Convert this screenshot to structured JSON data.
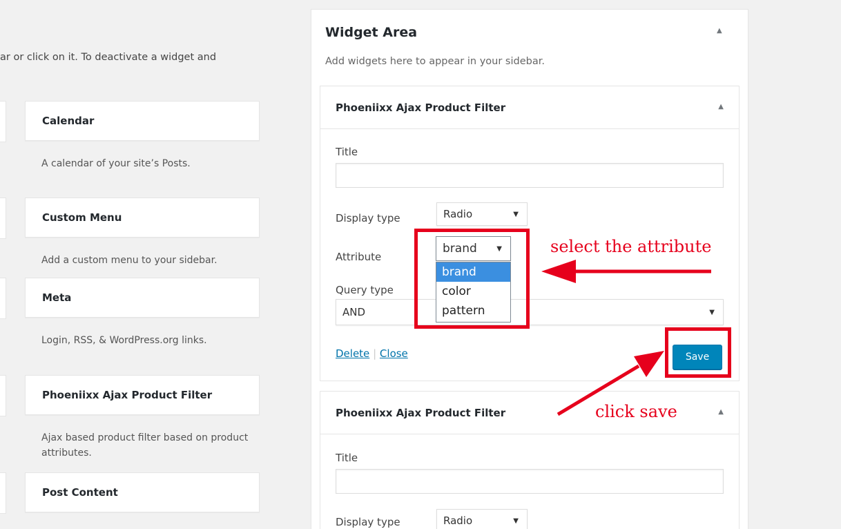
{
  "intro_text": "ar or click on it. To deactivate a widget and",
  "available_widgets": [
    {
      "name": "Calendar",
      "desc": "A calendar of your site’s Posts."
    },
    {
      "name": "Custom Menu",
      "desc": "Add a custom menu to your sidebar."
    },
    {
      "name": "Meta",
      "desc": "Login, RSS, & WordPress.org links."
    },
    {
      "name": "Phoeniixx Ajax Product Filter",
      "desc": "Ajax based product filter based on product attributes."
    },
    {
      "name": "Post Content",
      "desc": ""
    }
  ],
  "widget_area": {
    "title": "Widget Area",
    "desc": "Add widgets here to appear in your sidebar."
  },
  "widget1": {
    "title": "Phoeniixx Ajax Product Filter",
    "title_label": "Title",
    "title_value": "",
    "display_type_label": "Display type",
    "display_type_value": "Radio",
    "attribute_label": "Attribute",
    "attribute_value": "brand",
    "attribute_options": [
      "brand",
      "color",
      "pattern"
    ],
    "query_type_label": "Query type",
    "query_type_value": "AND",
    "delete_label": "Delete",
    "separator": "|",
    "close_label": "Close",
    "save_label": "Save"
  },
  "widget2": {
    "title": "Phoeniixx Ajax Product Filter",
    "title_label": "Title",
    "title_value": "",
    "display_type_label": "Display type",
    "display_type_value": "Radio"
  },
  "annotations": {
    "select_attribute": "select the attribute",
    "click_save": "click save"
  },
  "colors": {
    "annotation_red": "#e6001c",
    "primary_button": "#0085ba",
    "link": "#0073aa",
    "selected_option": "#3b8fe0"
  },
  "icons": {
    "collapse": "▲",
    "dropdown": "▼"
  }
}
